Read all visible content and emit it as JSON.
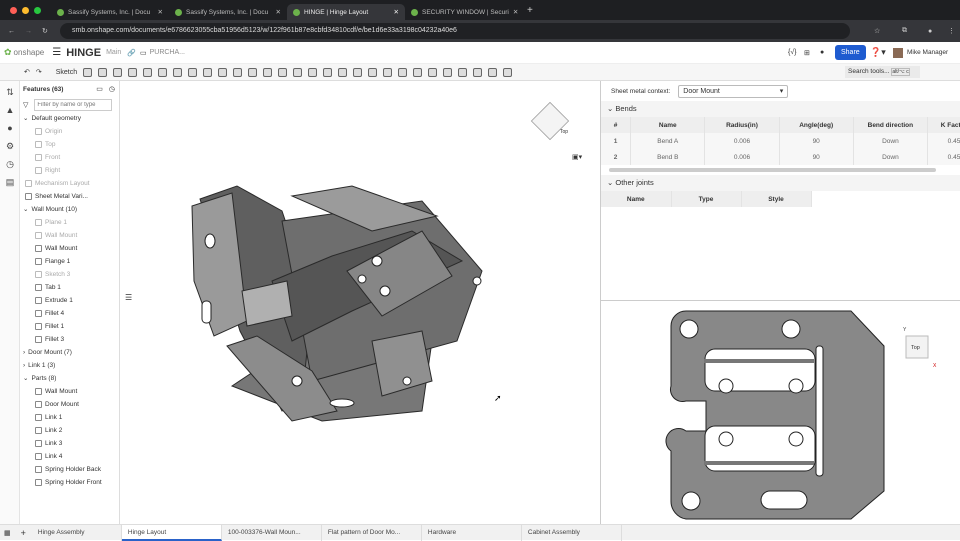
{
  "browser": {
    "tabs": [
      {
        "label": "Sassify Systems, Inc. | Docu"
      },
      {
        "label": "Sassify Systems, Inc. | Docu"
      },
      {
        "label": "HINGE | Hinge Layout"
      },
      {
        "label": "SECURITY WINDOW | Securi"
      }
    ],
    "url": "smb.onshape.com/documents/e6786623055cba51956d5123/w/122f961b87e8cbfd34810cdf/e/be1d6e33a3198c04232a40e6"
  },
  "header": {
    "logo": "onshape",
    "doc_title": "HINGE",
    "branch": "Main",
    "breadcrumb": "PURCHA...",
    "share": "Share",
    "user": "Mike Manager",
    "search_tools": "Search tools...",
    "shortcut": "alt/⌥ c"
  },
  "toolbar": {
    "sketch": "Sketch"
  },
  "features": {
    "title": "Features (63)",
    "filter_placeholder": "Filter by name or type",
    "items": [
      {
        "label": "Default geometry",
        "level": 0,
        "dim": false,
        "group": true
      },
      {
        "label": "Origin",
        "level": 1,
        "dim": true
      },
      {
        "label": "Top",
        "level": 1,
        "dim": true
      },
      {
        "label": "Front",
        "level": 1,
        "dim": true
      },
      {
        "label": "Right",
        "level": 1,
        "dim": true
      },
      {
        "label": "Mechanism Layout",
        "level": 0,
        "dim": true
      },
      {
        "label": "Sheet Metal Vari...",
        "level": 0,
        "dim": false
      },
      {
        "label": "Wall Mount (10)",
        "level": 0,
        "dim": false,
        "group": true
      },
      {
        "label": "Plane 1",
        "level": 1,
        "dim": true
      },
      {
        "label": "Wall Mount",
        "level": 1,
        "dim": true
      },
      {
        "label": "Wall Mount",
        "level": 1,
        "dim": false
      },
      {
        "label": "Flange 1",
        "level": 1,
        "dim": false
      },
      {
        "label": "Sketch 3",
        "level": 1,
        "dim": true
      },
      {
        "label": "Tab 1",
        "level": 1,
        "dim": false
      },
      {
        "label": "Extrude 1",
        "level": 1,
        "dim": false
      },
      {
        "label": "Fillet 4",
        "level": 1,
        "dim": false
      },
      {
        "label": "Fillet 1",
        "level": 1,
        "dim": false
      },
      {
        "label": "Fillet 3",
        "level": 1,
        "dim": false
      },
      {
        "label": "Door Mount (7)",
        "level": 0,
        "dim": false,
        "group": true,
        "collapsed": true
      },
      {
        "label": "Link 1 (3)",
        "level": 0,
        "dim": false,
        "group": true,
        "collapsed": true
      }
    ],
    "parts_title": "Parts (8)",
    "parts": [
      "Wall Mount",
      "Door Mount",
      "Link 1",
      "Link 2",
      "Link 3",
      "Link 4",
      "Spring Holder Back",
      "Spring Holder Front"
    ]
  },
  "sheet_metal": {
    "context_label": "Sheet metal context:",
    "context_value": "Door Mount",
    "bends_title": "Bends",
    "bend_columns": [
      "#",
      "Name",
      "Radius(in)",
      "Angle(deg)",
      "Bend direction",
      "K Factor"
    ],
    "bends": [
      [
        "1",
        "Bend A",
        "0.006",
        "90",
        "Down",
        "0.45"
      ],
      [
        "2",
        "Bend B",
        "0.006",
        "90",
        "Down",
        "0.45"
      ]
    ],
    "joints_title": "Other joints",
    "joint_columns": [
      "Name",
      "Type",
      "Style"
    ]
  },
  "viewcube": {
    "main": "Top",
    "flat": "Top"
  },
  "bottom_tabs": [
    "Hinge Assembly",
    "Hinge Layout",
    "100-003376-Wall Moun...",
    "Flat pattern of Door Mo...",
    "Hardware",
    "Cabinet Assembly"
  ],
  "colors": {
    "accent": "#1e5bd0",
    "chrome": "#1e1f22"
  }
}
